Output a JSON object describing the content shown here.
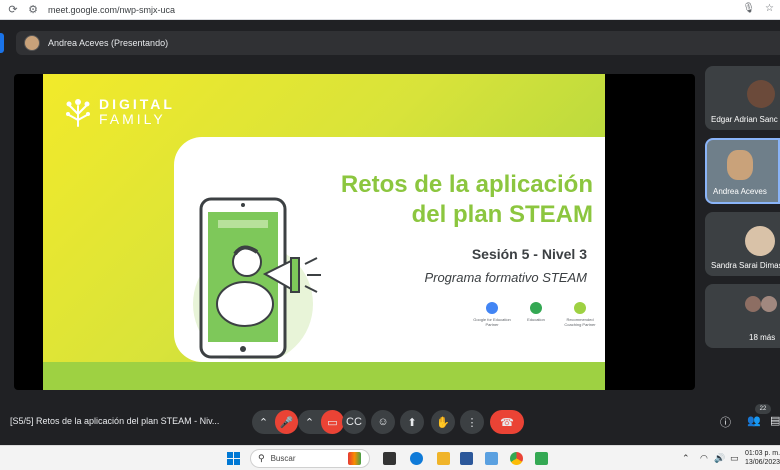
{
  "browser": {
    "url": "meet.google.com/nwp-smjx-uca"
  },
  "presenting": {
    "label": "Andrea Aceves (Presentando)"
  },
  "slide": {
    "brand_line1": "DIGITAL",
    "brand_line2": "FAMILY",
    "title_line1": "Retos de la aplicación",
    "title_line2": "del plan STEAM",
    "session": "Sesión 5 - Nivel 3",
    "program": "Programa formativo STEAM",
    "partners": [
      {
        "text": "Google for Education Partner",
        "color": "#4285f4"
      },
      {
        "text": "Education",
        "color": "#34a853"
      },
      {
        "text": "Recommended Coaching Partner",
        "color": "#9ed142"
      }
    ]
  },
  "participants": [
    {
      "name": "Edgar Adrian Sanc"
    },
    {
      "name": "Andrea Aceves"
    },
    {
      "name": "Sandra Sarai Dimas"
    },
    {
      "name": "18 más"
    }
  ],
  "controls": {
    "meeting_title": "[S5/5] Retos de la aplicación del plan STEAM - Niv...",
    "people_count": "22"
  },
  "taskbar": {
    "search_placeholder": "Buscar",
    "time": "01:03 p. m.",
    "date": "13/06/2023"
  },
  "colors": {
    "accent_blue": "#1a73e8",
    "mute_red": "#ea4335",
    "slide_green": "#8cc63f",
    "slide_yellow": "#f2ea2a"
  }
}
